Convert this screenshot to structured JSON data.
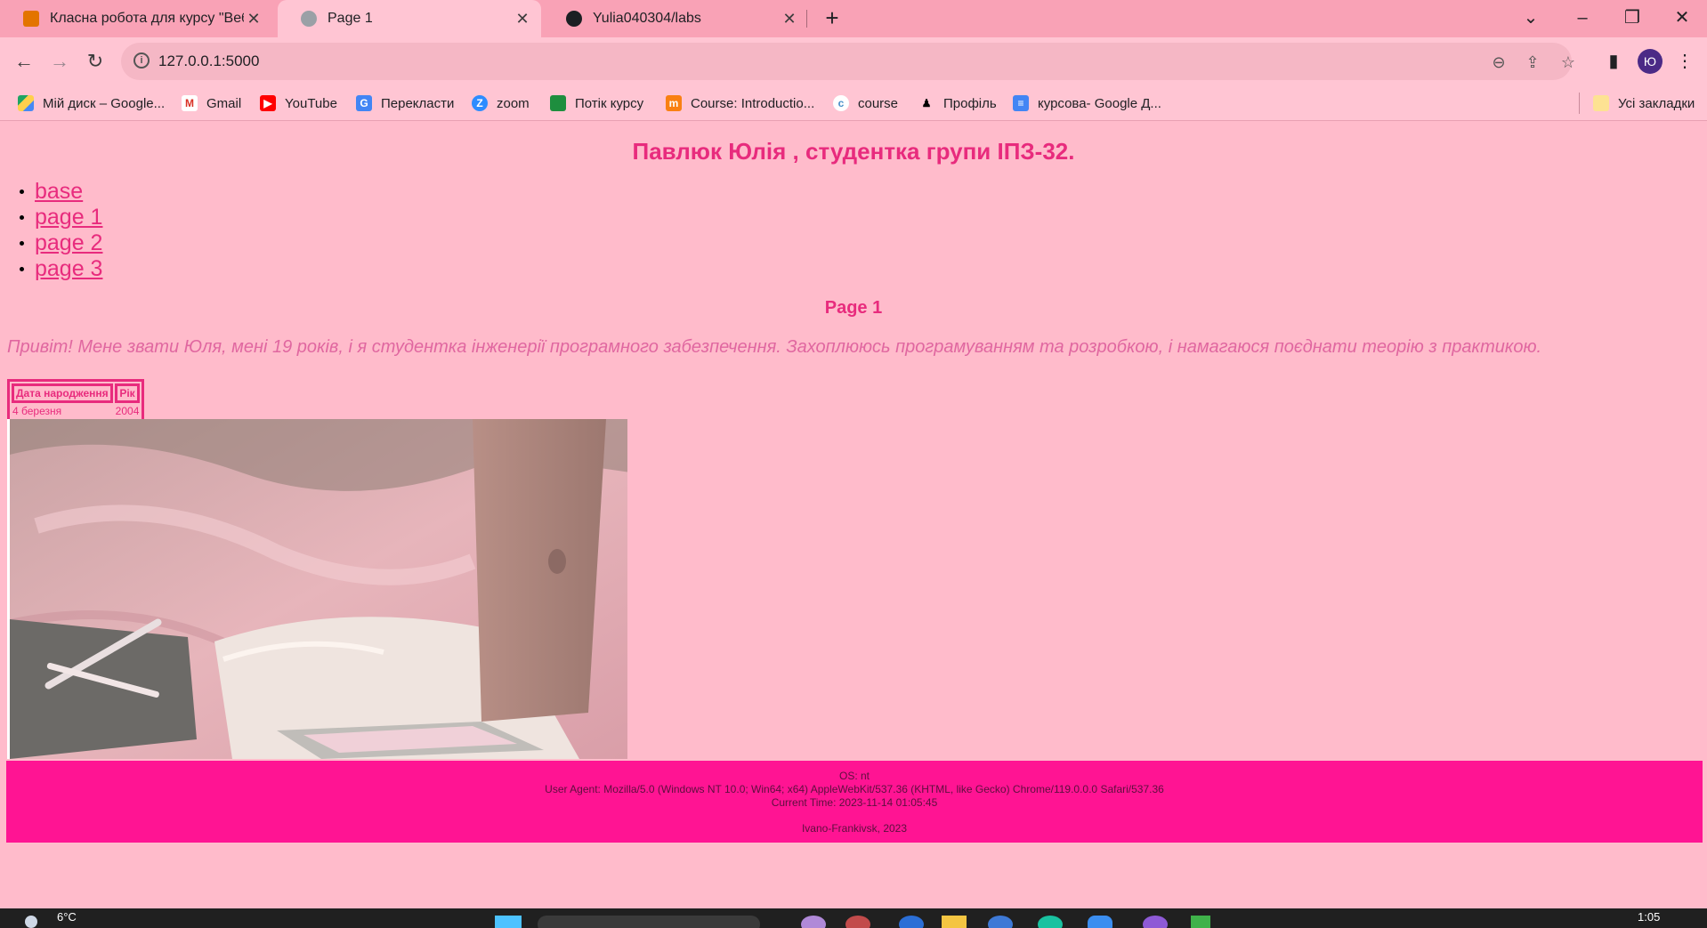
{
  "browser": {
    "tabs": [
      {
        "title": "Класна робота для курсу \"Вебп"
      },
      {
        "title": "Page 1"
      },
      {
        "title": "Yulia040304/labs"
      }
    ],
    "url": "127.0.0.1:5000",
    "profile_initial": "Ю",
    "bookmarks": [
      {
        "label": "Мій диск – Google..."
      },
      {
        "label": "Gmail"
      },
      {
        "label": "YouTube"
      },
      {
        "label": "Перекласти"
      },
      {
        "label": "zoom"
      },
      {
        "label": "Потік курсу"
      },
      {
        "label": "Course: Introductio..."
      },
      {
        "label": "course"
      },
      {
        "label": "Профіль"
      },
      {
        "label": "курсова- Google Д..."
      }
    ],
    "all_bookmarks_label": "Усі закладки"
  },
  "page": {
    "heading": "Павлюк Юлія , студентка групи ІПЗ-32.",
    "nav": [
      {
        "label": "base"
      },
      {
        "label": "page 1"
      },
      {
        "label": "page 2"
      },
      {
        "label": "page 3"
      }
    ],
    "subheading": "Page 1",
    "intro": "Привіт! Мене звати Юля, мені 19 років, і я студентка інженерії програмного забезпечення. Захоплююсь програмуванням та розробкою, і намагаюся поєднати теорію з практикою.",
    "table": {
      "headers": [
        "Дата народження",
        "Рік"
      ],
      "rows": [
        [
          "4 березня",
          "2004"
        ]
      ]
    },
    "footer": {
      "os": "OS: nt",
      "user_agent": "User Agent: Mozilla/5.0 (Windows NT 10.0; Win64; x64) AppleWebKit/537.36 (KHTML, like Gecko) Chrome/119.0.0.0 Safari/537.36",
      "time": "Current Time: 2023-11-14 01:05:45",
      "place": "Ivano-Frankivsk, 2023"
    }
  },
  "taskbar": {
    "weather": "6°C",
    "clock": "1:05"
  },
  "colors": {
    "accent": "#e82b7d",
    "background": "#ffbbcb",
    "footer": "#ff1493"
  }
}
